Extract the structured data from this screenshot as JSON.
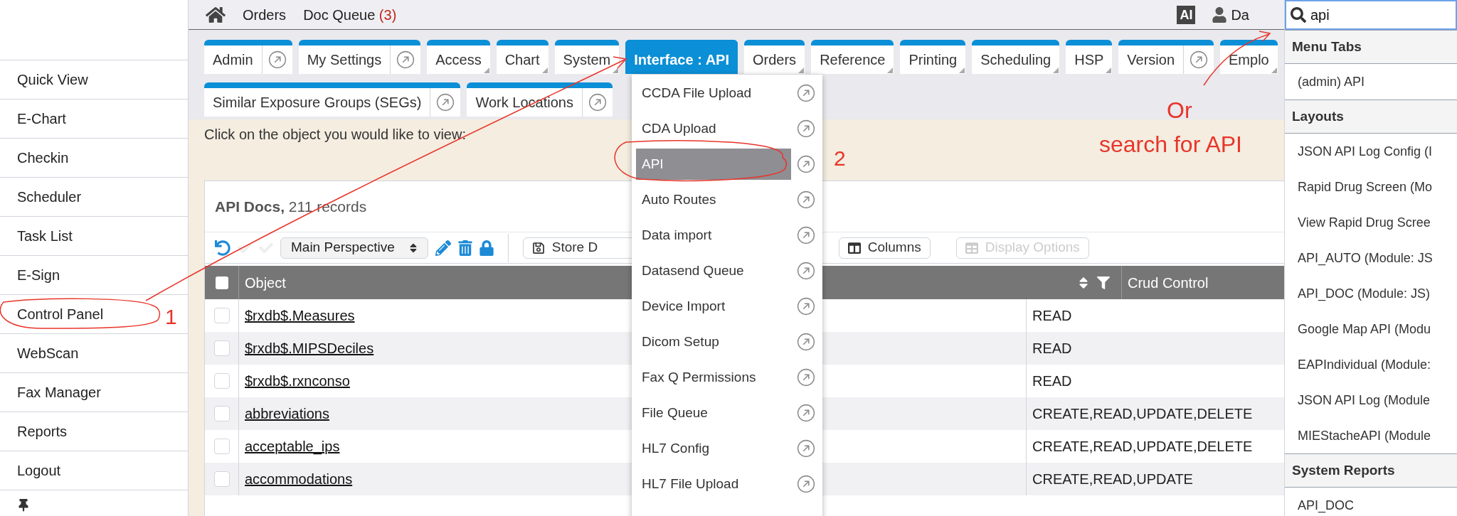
{
  "sidebar": {
    "items": [
      {
        "label": "Quick View"
      },
      {
        "label": "E-Chart"
      },
      {
        "label": "Checkin"
      },
      {
        "label": "Scheduler"
      },
      {
        "label": "Task List"
      },
      {
        "label": "E-Sign"
      },
      {
        "label": "Control Panel"
      },
      {
        "label": "WebScan"
      },
      {
        "label": "Fax Manager"
      },
      {
        "label": "Reports"
      },
      {
        "label": "Logout"
      }
    ]
  },
  "top_bar": {
    "links": [
      {
        "label": "Orders"
      },
      {
        "label": "Doc Queue",
        "count": "(3)"
      }
    ],
    "ai_badge": "AI",
    "user": "Da"
  },
  "tab_rows": [
    [
      {
        "label": "Admin",
        "kind": "link",
        "selected": false
      },
      {
        "label": "My Settings",
        "kind": "link",
        "selected": false
      },
      {
        "label": "Access",
        "kind": "menu",
        "selected": false
      },
      {
        "label": "Chart",
        "kind": "menu",
        "selected": false
      },
      {
        "label": "System",
        "kind": "menu",
        "selected": false
      },
      {
        "label": "Interface : API",
        "kind": "menu",
        "selected": true
      },
      {
        "label": "Orders",
        "kind": "menu",
        "selected": false
      },
      {
        "label": "Reference",
        "kind": "menu",
        "selected": false
      },
      {
        "label": "Printing",
        "kind": "menu",
        "selected": false
      },
      {
        "label": "Scheduling",
        "kind": "menu",
        "selected": false
      },
      {
        "label": "HSP",
        "kind": "menu",
        "selected": false
      },
      {
        "label": "Version",
        "kind": "link",
        "selected": false
      },
      {
        "label": "Emplo",
        "kind": "menu",
        "selected": false
      }
    ],
    [
      {
        "label": "Similar Exposure Groups (SEGs)",
        "kind": "link",
        "selected": false
      },
      {
        "label": "Work Locations",
        "kind": "link",
        "selected": false
      }
    ]
  ],
  "instruction": "Click on the object you would like to view:",
  "table": {
    "title": "**API Docs,** 211 records",
    "perspective": "Main Perspective",
    "buttons": [
      {
        "label": "Store D",
        "kind": "save",
        "disabled": false
      },
      {
        "label": "Columns",
        "kind": "columns",
        "disabled": false
      },
      {
        "label": "Display Options",
        "kind": "options",
        "disabled": true
      }
    ],
    "columns": [
      "Object",
      "Crud Control"
    ],
    "header_checked": false,
    "rows": [
      {
        "object": "$rxdb$.Measures",
        "crud": "READ",
        "checked": false
      },
      {
        "object": "$rxdb$.MIPSDeciles",
        "crud": "READ",
        "checked": false
      },
      {
        "object": "$rxdb$.rxnconso",
        "crud": "READ",
        "checked": false
      },
      {
        "object": "abbreviations",
        "crud": "CREATE,READ,UPDATE,DELETE",
        "checked": false
      },
      {
        "object": "acceptable_ips",
        "crud": "CREATE,READ,UPDATE,DELETE",
        "checked": false
      },
      {
        "object": "accommodations",
        "crud": "CREATE,READ,UPDATE",
        "checked": false
      }
    ]
  },
  "dropdown": {
    "items": [
      {
        "label": "CCDA File Upload",
        "selected": false
      },
      {
        "label": "CDA Upload",
        "selected": false
      },
      {
        "label": "API",
        "selected": true
      },
      {
        "label": "Auto Routes",
        "selected": false
      },
      {
        "label": "Data import",
        "selected": false
      },
      {
        "label": "Datasend Queue",
        "selected": false
      },
      {
        "label": "Device Import",
        "selected": false
      },
      {
        "label": "Dicom Setup",
        "selected": false
      },
      {
        "label": "Fax Q Permissions",
        "selected": false
      },
      {
        "label": "File Queue",
        "selected": false
      },
      {
        "label": "HL7 Config",
        "selected": false
      },
      {
        "label": "HL7 File Upload",
        "selected": false
      }
    ]
  },
  "search": {
    "value": "api",
    "sections": [
      {
        "title": "Menu Tabs",
        "results": [
          "(admin) API"
        ]
      },
      {
        "title": "Layouts",
        "results": [
          "JSON API Log Config (I",
          "Rapid Drug Screen (Mo",
          "View Rapid Drug Scree",
          "API_AUTO (Module: JS",
          "API_DOC (Module: JS)",
          "Google Map API (Modu",
          "EAPIndividual (Module:",
          "JSON API Log (Module",
          "MIEStacheAPI (Module"
        ]
      },
      {
        "title": "System Reports",
        "results": [
          "API_DOC"
        ]
      }
    ]
  },
  "annotations": [
    {
      "text": "1"
    },
    {
      "text": "2"
    },
    {
      "text": "Or"
    },
    {
      "text": "search for API"
    }
  ]
}
